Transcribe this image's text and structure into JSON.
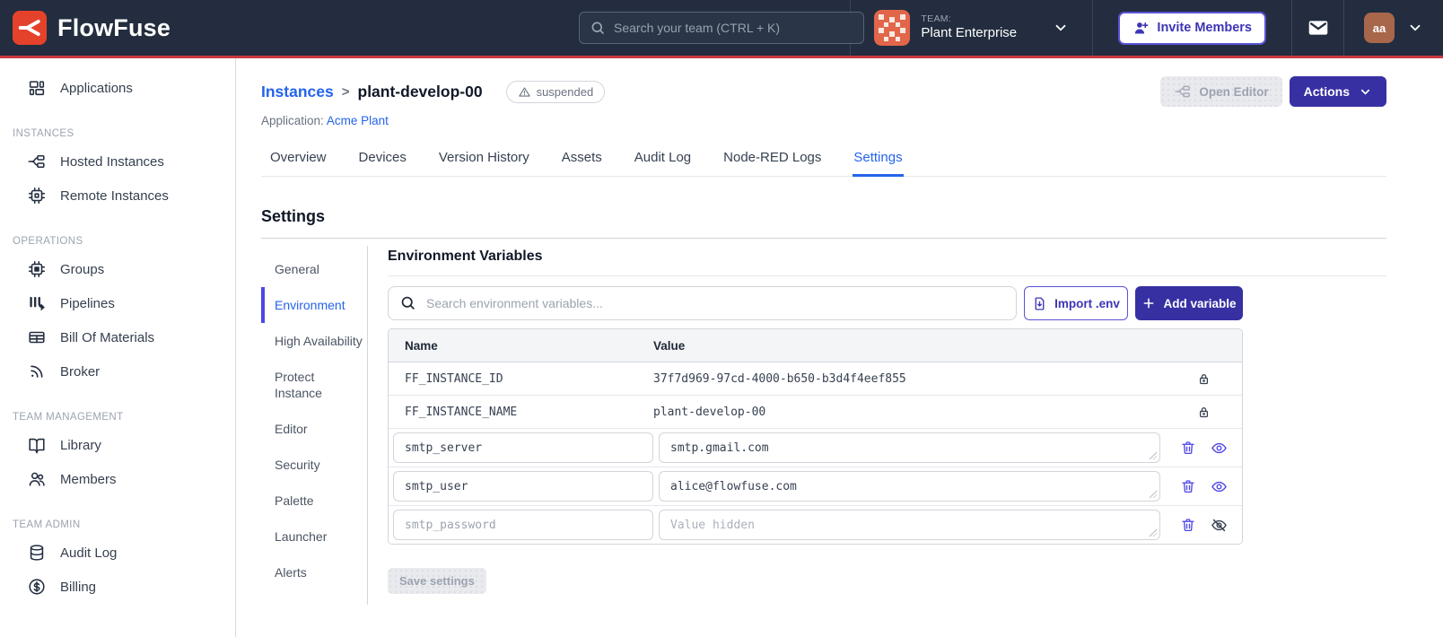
{
  "colors": {
    "navbar_bg": "#232d3f",
    "accent_red_line": "#c93a3e",
    "brand_red": "#e5422b",
    "primary_indigo": "#3730a3",
    "indigo_border": "#5b51d6",
    "link_blue": "#2563eb",
    "team_avatar_orange": "#e2664a",
    "user_avatar_brown": "#a8674b"
  },
  "navbar": {
    "brand": "FlowFuse",
    "search": {
      "placeholder": "Search your team (CTRL + K)"
    },
    "team": {
      "label": "TEAM:",
      "name": "Plant Enterprise"
    },
    "invite_button": "Invite Members",
    "avatar_initials": "aa"
  },
  "sidebar": {
    "sections": [
      {
        "label": "",
        "items": [
          {
            "label": "Applications",
            "icon": "applications-icon"
          }
        ]
      },
      {
        "label": "INSTANCES",
        "items": [
          {
            "label": "Hosted Instances",
            "icon": "hosted-instances-icon"
          },
          {
            "label": "Remote Instances",
            "icon": "remote-instances-icon"
          }
        ]
      },
      {
        "label": "OPERATIONS",
        "items": [
          {
            "label": "Groups",
            "icon": "groups-icon"
          },
          {
            "label": "Pipelines",
            "icon": "pipelines-icon"
          },
          {
            "label": "Bill Of Materials",
            "icon": "bill-of-materials-icon"
          },
          {
            "label": "Broker",
            "icon": "broker-icon"
          }
        ]
      },
      {
        "label": "TEAM MANAGEMENT",
        "items": [
          {
            "label": "Library",
            "icon": "library-icon"
          },
          {
            "label": "Members",
            "icon": "members-icon"
          }
        ]
      },
      {
        "label": "TEAM ADMIN",
        "items": [
          {
            "label": "Audit Log",
            "icon": "audit-log-icon"
          },
          {
            "label": "Billing",
            "icon": "billing-icon"
          }
        ]
      }
    ]
  },
  "header": {
    "breadcrumb_parent": "Instances",
    "breadcrumb_separator": ">",
    "breadcrumb_current": "plant-develop-00",
    "status_badge": "suspended",
    "application_label": "Application:",
    "application_name": "Acme Plant",
    "open_editor_button": "Open Editor",
    "actions_button": "Actions"
  },
  "tabs": [
    {
      "label": "Overview",
      "active": false
    },
    {
      "label": "Devices",
      "active": false
    },
    {
      "label": "Version History",
      "active": false
    },
    {
      "label": "Assets",
      "active": false
    },
    {
      "label": "Audit Log",
      "active": false
    },
    {
      "label": "Node-RED Logs",
      "active": false
    },
    {
      "label": "Settings",
      "active": true
    }
  ],
  "settings": {
    "title": "Settings",
    "nav": [
      {
        "label": "General",
        "active": false
      },
      {
        "label": "Environment",
        "active": true
      },
      {
        "label": "High Availability",
        "active": false
      },
      {
        "label": "Protect Instance",
        "active": false
      },
      {
        "label": "Editor",
        "active": false
      },
      {
        "label": "Security",
        "active": false
      },
      {
        "label": "Palette",
        "active": false
      },
      {
        "label": "Launcher",
        "active": false
      },
      {
        "label": "Alerts",
        "active": false
      }
    ]
  },
  "env": {
    "title": "Environment Variables",
    "search_placeholder": "Search environment variables...",
    "import_button": "Import .env",
    "add_button": "Add variable",
    "table": {
      "headers": [
        "Name",
        "Value"
      ],
      "locked_rows": [
        {
          "name": "FF_INSTANCE_ID",
          "value": "37f7d969-97cd-4000-b650-b3d4f4eef855"
        },
        {
          "name": "FF_INSTANCE_NAME",
          "value": "plant-develop-00"
        }
      ],
      "editable_rows": [
        {
          "name": "smtp_server",
          "value": "smtp.gmail.com",
          "value_placeholder": "",
          "visibility": "visible"
        },
        {
          "name": "smtp_user",
          "value": "alice@flowfuse.com",
          "value_placeholder": "",
          "visibility": "visible"
        },
        {
          "name": "smtp_password",
          "value": "",
          "value_placeholder": "Value hidden",
          "visibility": "hidden"
        }
      ]
    },
    "save_button": "Save settings"
  }
}
